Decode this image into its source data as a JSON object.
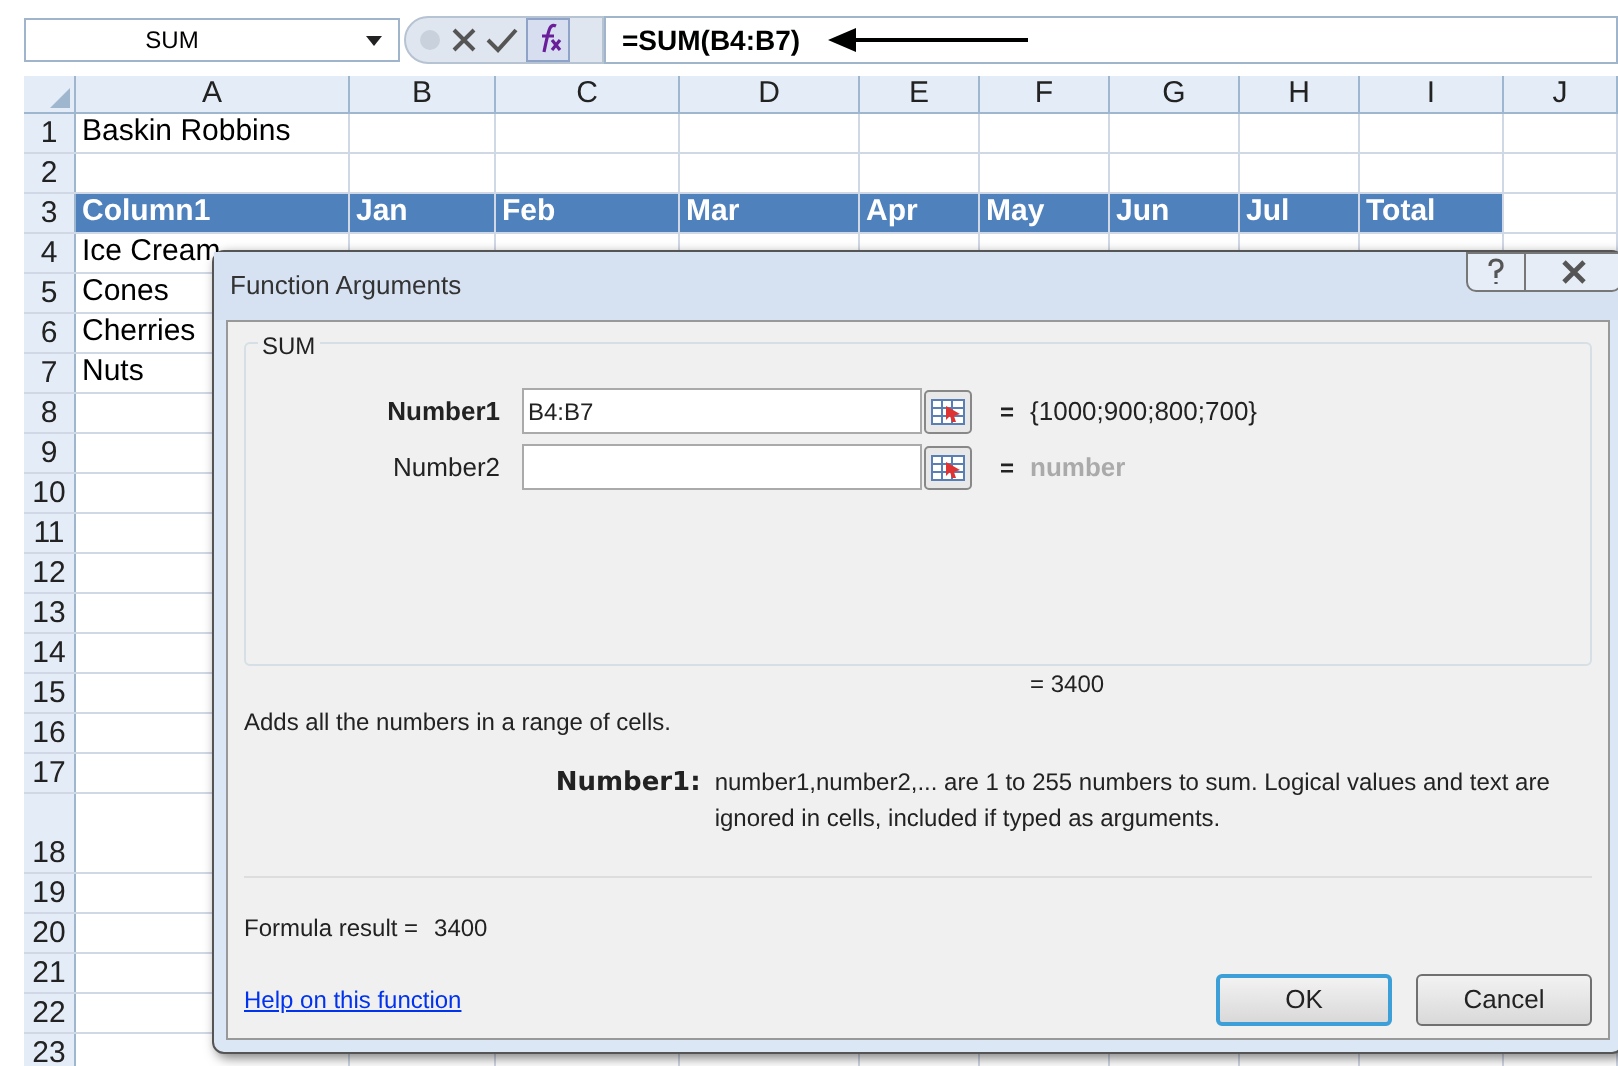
{
  "formula_bar": {
    "name_box": "SUM",
    "formula": "=SUM(B4:B7)"
  },
  "sheet": {
    "columns": [
      "A",
      "B",
      "C",
      "D",
      "E",
      "F",
      "G",
      "H",
      "I",
      "J"
    ],
    "rows": [
      {
        "header": "1",
        "kind": "plain",
        "cells": [
          "Baskin Robbins"
        ]
      },
      {
        "header": "2",
        "kind": "plain",
        "cells": []
      },
      {
        "header": "3",
        "kind": "table_header",
        "cells": [
          "Column1",
          "Jan",
          "Feb",
          "Mar",
          "Apr",
          "May",
          "Jun",
          "Jul",
          "Total"
        ]
      },
      {
        "header": "4",
        "kind": "plain",
        "cells": [
          "Ice Cream"
        ]
      },
      {
        "header": "5",
        "kind": "plain",
        "cells": [
          "Cones"
        ]
      },
      {
        "header": "6",
        "kind": "plain",
        "cells": [
          "Cherries"
        ]
      },
      {
        "header": "7",
        "kind": "plain",
        "cells": [
          "Nuts"
        ]
      },
      {
        "header": "8",
        "kind": "plain",
        "cells": []
      },
      {
        "header": "9",
        "kind": "plain",
        "cells": []
      },
      {
        "header": "10",
        "kind": "plain",
        "cells": []
      },
      {
        "header": "11",
        "kind": "plain",
        "cells": []
      },
      {
        "header": "12",
        "kind": "plain",
        "cells": []
      },
      {
        "header": "13",
        "kind": "plain",
        "cells": []
      },
      {
        "header": "14",
        "kind": "plain",
        "cells": []
      },
      {
        "header": "15",
        "kind": "plain",
        "cells": []
      },
      {
        "header": "16",
        "kind": "plain",
        "cells": []
      },
      {
        "header": "17",
        "kind": "plain",
        "cells": []
      },
      {
        "header": "18",
        "kind": "tall",
        "cells": []
      },
      {
        "header": "19",
        "kind": "plain",
        "cells": []
      },
      {
        "header": "20",
        "kind": "plain",
        "cells": []
      },
      {
        "header": "21",
        "kind": "plain",
        "cells": []
      },
      {
        "header": "22",
        "kind": "plain",
        "cells": []
      },
      {
        "header": "23",
        "kind": "plain",
        "cells": []
      }
    ]
  },
  "dialog": {
    "title": "Function Arguments",
    "group": "SUM",
    "arguments": [
      {
        "label": "Number1",
        "value": "B4:B7",
        "equals": "=",
        "result": "{1000;900;800;700}",
        "selected": true
      },
      {
        "label": "Number2",
        "equals": "=",
        "result": "number",
        "selected": false
      }
    ],
    "total": "= 3400",
    "description": "Adds all the numbers in a range of cells.",
    "argument_help": {
      "label": "Number1:",
      "text": "number1,number2,... are 1 to 255 numbers to sum. Logical values and text are ignored in cells, included if typed as arguments."
    },
    "formula_result": {
      "label": "Formula result =",
      "value": "3400"
    },
    "help_link": "Help on this function",
    "buttons": [
      {
        "label": "OK",
        "selected": true
      },
      {
        "label": "Cancel",
        "selected": false
      }
    ]
  }
}
